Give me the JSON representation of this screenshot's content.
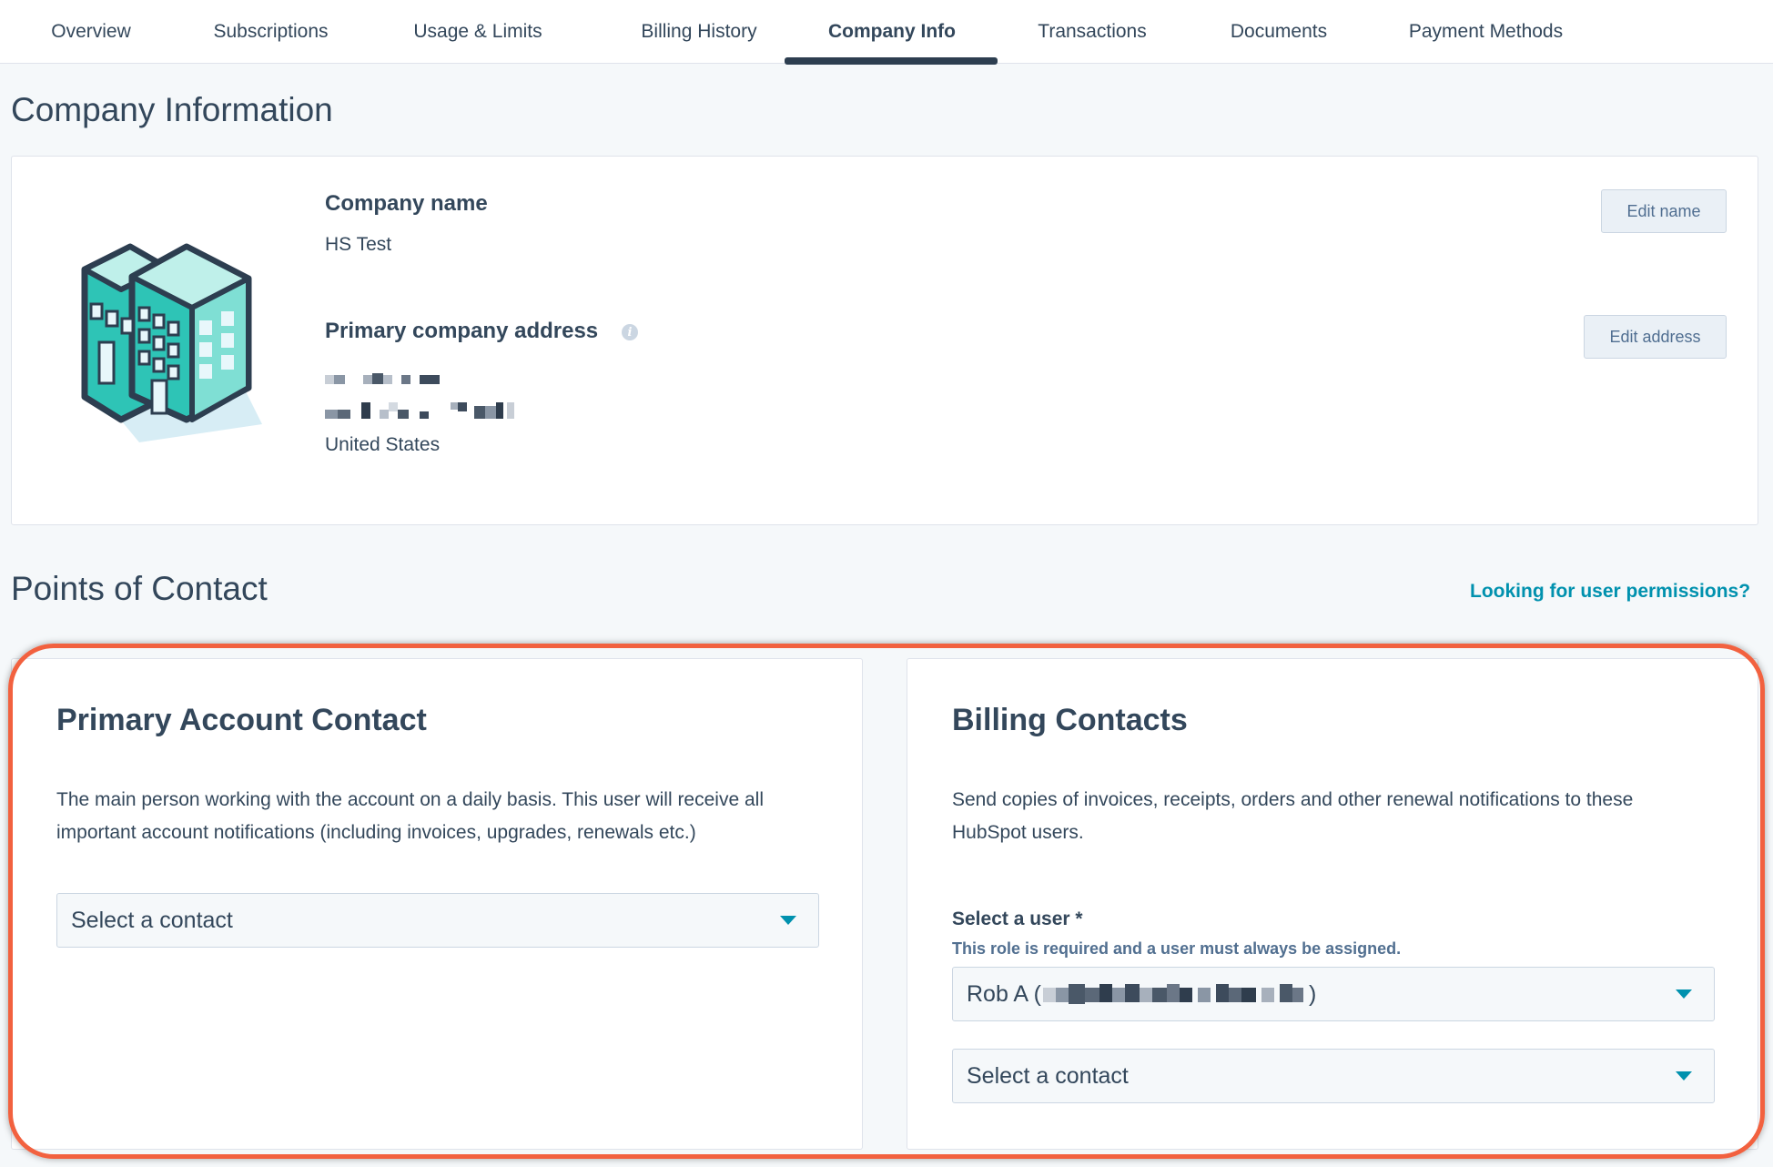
{
  "tabs": [
    {
      "label": "Overview"
    },
    {
      "label": "Subscriptions"
    },
    {
      "label": "Usage & Limits"
    },
    {
      "label": "Billing History"
    },
    {
      "label": "Company Info"
    },
    {
      "label": "Transactions"
    },
    {
      "label": "Documents"
    },
    {
      "label": "Payment Methods"
    }
  ],
  "active_tab": "Company Info",
  "company_info": {
    "heading": "Company Information",
    "company_name_label": "Company name",
    "company_name_value": "HS Test",
    "edit_name_label": "Edit name",
    "address_label": "Primary company address",
    "address_country": "United States",
    "edit_address_label": "Edit address"
  },
  "points_of_contact": {
    "heading": "Points of Contact",
    "permissions_link": "Looking for user permissions?"
  },
  "primary_account_contact": {
    "title": "Primary Account Contact",
    "description": "The main person working with the account on a daily basis. This user will receive all important account notifications (including invoices, upgrades, renewals etc.)",
    "select_placeholder": "Select a contact"
  },
  "billing_contacts": {
    "title": "Billing Contacts",
    "description": "Send copies of invoices, receipts, orders and other renewal notifications to these HubSpot users.",
    "select_user_label": "Select a user *",
    "helper_text": "This role is required and a user must always be assigned.",
    "selected_user_prefix": "Rob A (",
    "selected_user_suffix": ")",
    "second_select_placeholder": "Select a contact"
  },
  "colors": {
    "text": "#33475b",
    "link": "#0091ae",
    "highlight": "#f2613f",
    "building_teal": "#2ec4b6",
    "building_outline": "#2d3e50"
  },
  "icons": {
    "dropdown": "caret-down-icon",
    "info": "info-icon",
    "illustration": "building-icon"
  }
}
